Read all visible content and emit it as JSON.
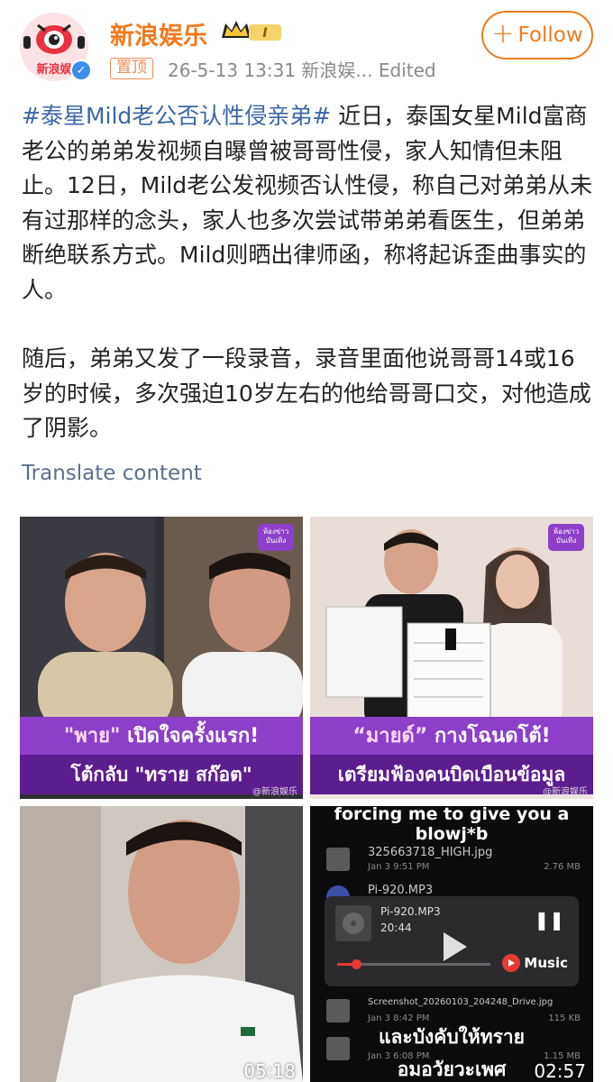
{
  "account": {
    "name": "新浪娱乐",
    "badge_text": "I",
    "pinned_label": "置顶",
    "meta": "26-5-13 13:31  新浪娱...   Edited",
    "follow_label": "Follow",
    "avatar_text": "新浪娱",
    "verified_mark": "✓"
  },
  "post": {
    "hashtag": "#泰星Mild老公否认性侵亲弟#",
    "para1_rest": " 近日，泰国女星Mild富商老公的弟弟发视频自曝曾被哥哥性侵，家人知情但未阻止。12日，Mild老公发视频否认性侵，称自己对弟弟从未有过那样的念头，家人也多次尝试带弟弟看医生，但弟弟断绝联系方式。Mild则晒出律师函，称将起诉歪曲事实的人。",
    "para2": "随后，弟弟又发了一段录音，录音里面他说哥哥14或16岁的时候，多次强迫10岁左右的他给哥哥口交，对他造成了阴影。",
    "translate_label": "Translate content"
  },
  "media": {
    "tile1": {
      "logo": "ห้องข่าว บันเทิง",
      "line1_accent": "\"พาย\"",
      "line1_rest": " เปิดใจครั้งแรก!",
      "line2": "โต้กลับ \"ทราย สก๊อต\"",
      "watermark": "@新浪娱乐"
    },
    "tile2": {
      "logo": "ห้องข่าว บันเทิง",
      "line1_accent": "“มายด์”",
      "line1_rest": " กางโฉนดโต้!",
      "line2": "เตรียมฟ้องคนบิดเบือนข้อมูล",
      "watermark": "@新浪娱乐"
    },
    "tile3": {
      "duration": "05:18"
    },
    "tile4": {
      "caption_top": "forcing me to give you a",
      "caption_top2": "blowj*b",
      "files": [
        {
          "name": "325663718_HIGH.jpg",
          "date": "Jan 3 9:51 PM",
          "size": "2.76 MB"
        },
        {
          "name": "Pi-920.MP3",
          "date": "",
          "size": ""
        },
        {
          "name": "Screenshot_20260103_204248_Drive.jpg",
          "date": "Jan 3 8:42 PM",
          "size": "115 KB"
        },
        {
          "name": "",
          "date": "Jan 3 6:08 PM",
          "size": "1.15 MB"
        }
      ],
      "player": {
        "track": "Pi-920.MP3",
        "time": "20:44",
        "brand": "Music"
      },
      "caption_bottom": "และบังคับให้ทราย",
      "caption_bottom2": "อมอวัยวะเพศ",
      "duration": "02:57"
    }
  }
}
